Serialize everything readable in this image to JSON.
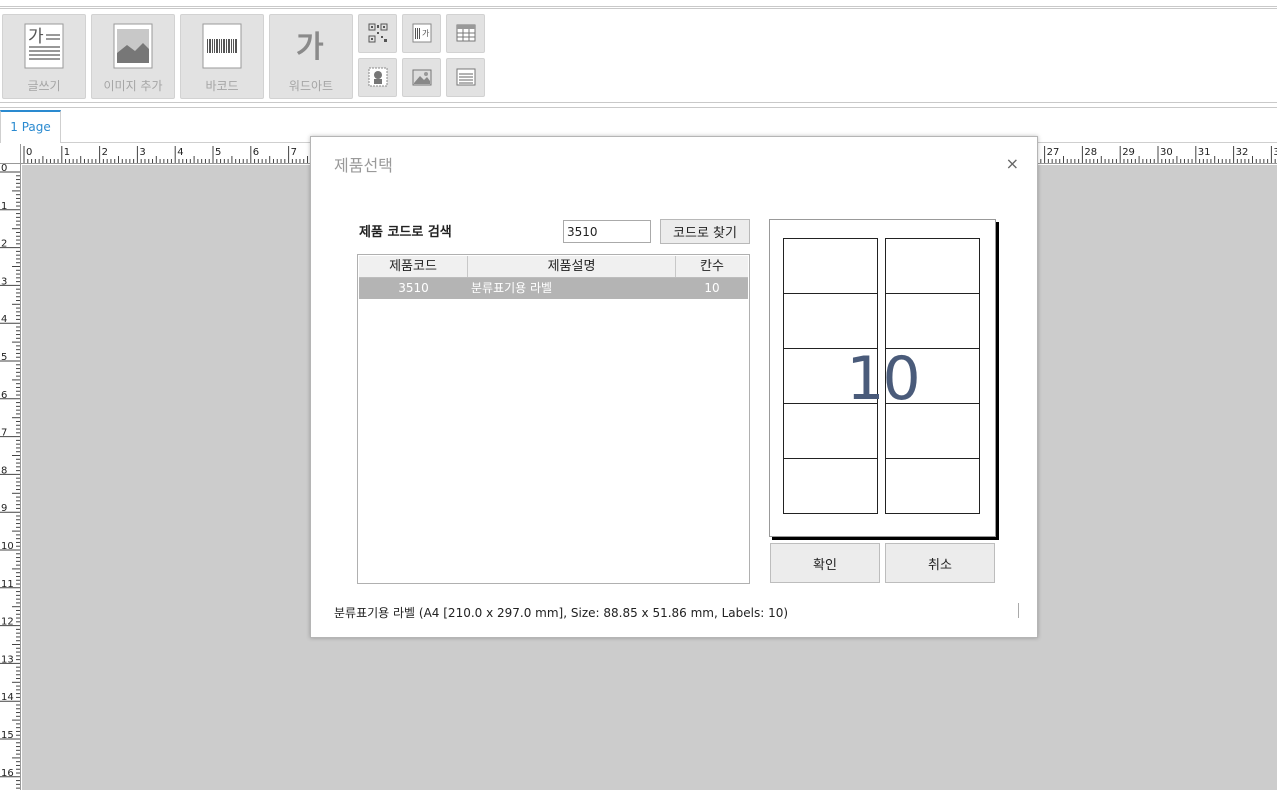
{
  "toolbar": {
    "big_tools": [
      {
        "label": "글쓰기",
        "icon": "text-icon"
      },
      {
        "label": "이미지 추가",
        "icon": "image-icon"
      },
      {
        "label": "바코드",
        "icon": "barcode-icon"
      },
      {
        "label": "워드아트",
        "icon": "wordart-icon"
      }
    ],
    "text_icon_glyph": "가",
    "wordart_glyph": "가",
    "small_tools": [
      "qrcode-icon",
      "vertical-text-icon",
      "table-icon",
      "stamp-icon",
      "picture-icon",
      "lines-icon"
    ]
  },
  "tabs": [
    {
      "label": "1 Page"
    }
  ],
  "ruler": {
    "h_visible_before": [
      "0",
      "1",
      "2",
      "3",
      "4",
      "5",
      "6",
      "7"
    ],
    "h_visible_after": [
      "27",
      "28",
      "29",
      "30",
      "31",
      "32",
      "3"
    ],
    "v_labels": [
      "0",
      "1",
      "2",
      "3",
      "4",
      "5",
      "6",
      "7",
      "8",
      "9",
      "10",
      "11",
      "12",
      "13",
      "14",
      "15",
      "16"
    ]
  },
  "dialog": {
    "title": "제품선택",
    "close": "×",
    "search_label": "제품 코드로 검색",
    "search_value": "3510",
    "search_button": "코드로 찾기",
    "columns": [
      "제품코드",
      "제품설명",
      "칸수"
    ],
    "rows": [
      {
        "code": "3510",
        "desc": "분류표기용 라벨",
        "count": "10"
      }
    ],
    "preview_count": "10",
    "preview_labels": 10,
    "ok_button": "확인",
    "cancel_button": "취소",
    "status": "분류표기용 라벨 (A4 [210.0 x 297.0 mm], Size: 88.85 x 51.86 mm, Labels: 10)"
  },
  "colors": {
    "accent": "#2a8ad0",
    "canvas": "#cccccc",
    "selected_row": "#b4b4b4",
    "preview_number": "#4a5b7a"
  }
}
